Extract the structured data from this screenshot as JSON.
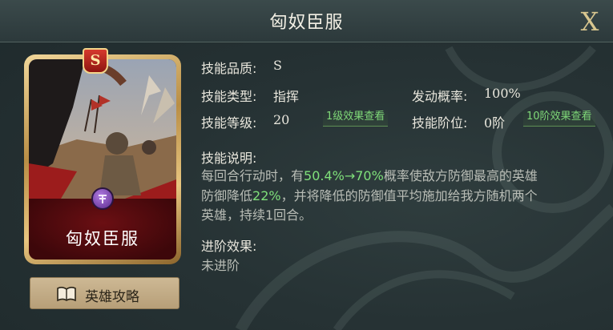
{
  "dialog": {
    "title": "匈奴臣服",
    "close_label": "X"
  },
  "card": {
    "grade": "S",
    "name": "匈奴臣服",
    "colors": {
      "frame": "#d7b46c",
      "name_bg": "#5a0c10",
      "emblem": "#8d52c4"
    }
  },
  "guide_button": {
    "icon": "book-icon",
    "label": "英雄攻略"
  },
  "skill": {
    "quality_label": "技能品质:",
    "quality_value": "S",
    "type_label": "技能类型:",
    "type_value": "指挥",
    "trigger_label": "发动概率:",
    "trigger_value": "100%",
    "level_label": "技能等级:",
    "level_value": "20",
    "level_effect_button": "1级效果查看",
    "rank_label": "技能阶位:",
    "rank_value": "0阶",
    "rank_effect_button": "10阶效果查看",
    "desc_label": "技能说明:",
    "desc_part1": "每回合行动时，有",
    "desc_hl1": "50.4%→70%",
    "desc_part2": "概率使敌方防御最高的英雄",
    "desc_part3": "防御降低",
    "desc_hl2": "22%",
    "desc_part4": "，并将降低的防御值平均施加给我方随机两个",
    "desc_part5": "英雄，持续1回合。",
    "advance_label": "进阶效果:",
    "advance_value": "未进阶"
  },
  "colors": {
    "highlight": "#7fe07a",
    "effect_button_text": "#7fd878",
    "close": "#d8c68f"
  }
}
